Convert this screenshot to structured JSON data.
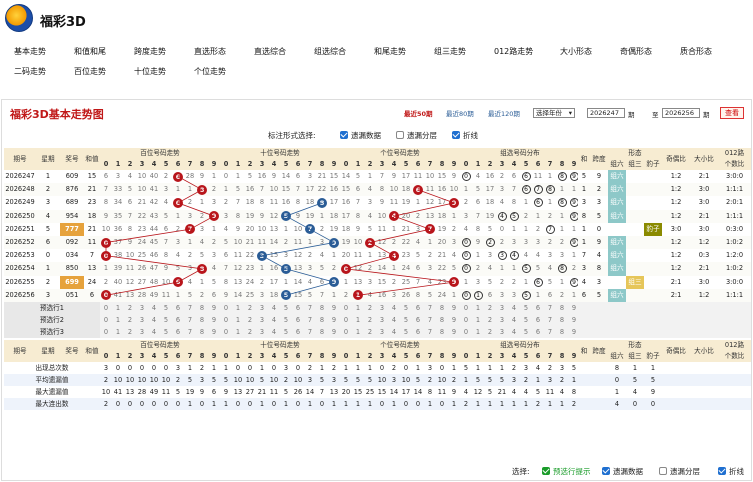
{
  "app": {
    "title": "福彩3D"
  },
  "nav": {
    "items": [
      "基本走势",
      "和值和尾",
      "跨度走势",
      "直选形态",
      "直选综合",
      "组选综合",
      "和尾走势",
      "组三走势",
      "012路走势",
      "大小形态",
      "奇偶形态",
      "质合形态",
      "二码走势",
      "百位走势",
      "十位走势",
      "个位走势"
    ]
  },
  "chart": {
    "title": "福彩3D基本走势图",
    "periods": [
      {
        "label": "最近50期",
        "active": true
      },
      {
        "label": "最近80期",
        "active": false
      },
      {
        "label": "最近120期",
        "active": false
      }
    ],
    "select_label": "选择年份",
    "from": "2026247",
    "to": "2026256",
    "from_suffix": "期",
    "to_label": "至",
    "to_suffix": "期",
    "query_btn": "查看",
    "options_label": "标注形式选择:",
    "options": [
      {
        "label": "遗漏数据",
        "checked": true
      },
      {
        "label": "遗漏分层",
        "checked": false
      },
      {
        "label": "折线",
        "checked": true
      }
    ]
  },
  "headers": {
    "issue": "期号",
    "week": "星期",
    "prize": "奖号",
    "sum": "和值",
    "bai": "百位号码走势",
    "shi": "十位号码走势",
    "ge": "个位号码走势",
    "group": "组选号码分布",
    "hw": "和尾",
    "span": "跨度",
    "shape": "形态",
    "zl": "组六",
    "zs": "组三",
    "bz": "豹子",
    "oe": "奇偶比",
    "bs": "大小比",
    "r012": "012路",
    "r012b": "个数比",
    "digits": [
      "0",
      "1",
      "2",
      "3",
      "4",
      "5",
      "6",
      "7",
      "8",
      "9"
    ]
  },
  "rows": [
    {
      "issue": "2026247",
      "week": "1",
      "prize": "609",
      "sum": "15",
      "bai": [
        6,
        3,
        4,
        10,
        40,
        2,
        "*",
        28,
        9,
        1
      ],
      "shi": [
        0,
        1,
        5,
        16,
        9,
        14,
        6,
        3,
        21,
        15
      ],
      "ge": [
        14,
        5,
        1,
        7,
        9,
        17,
        11,
        10,
        15,
        9
      ],
      "grp": [
        "0",
        4,
        16,
        2,
        6,
        "6",
        11,
        1,
        "8",
        "9"
      ],
      "hw": "5",
      "span": "9",
      "shape": "组六",
      "oe": "1:2",
      "bs": "2:1",
      "r012": "3:0:0",
      "hot": [
        0,
        6,
        9
      ]
    },
    {
      "issue": "2026248",
      "week": "2",
      "prize": "876",
      "sum": "21",
      "bai": [
        7,
        33,
        5,
        10,
        41,
        3,
        1,
        1,
        "*",
        2
      ],
      "shi": [
        1,
        5,
        16,
        7,
        10,
        15,
        7,
        17,
        22,
        16
      ],
      "ge": [
        15,
        6,
        4,
        8,
        10,
        18,
        "*",
        11,
        16,
        10
      ],
      "grp": [
        1,
        5,
        17,
        3,
        7,
        "6",
        "7",
        "8",
        1,
        1
      ],
      "hw": "1",
      "span": "2",
      "shape": "组六",
      "oe": "1:2",
      "bs": "3:0",
      "r012": "1:1:1",
      "hot": [
        6,
        7,
        8
      ]
    },
    {
      "issue": "2026249",
      "week": "3",
      "prize": "689",
      "sum": "23",
      "bai": [
        8,
        34,
        6,
        21,
        42,
        4,
        "*",
        2,
        1,
        3
      ],
      "shi": [
        2,
        7,
        18,
        8,
        11,
        16,
        8,
        18,
        "*",
        17
      ],
      "ge": [
        16,
        7,
        3,
        9,
        11,
        19,
        1,
        12,
        17,
        "*"
      ],
      "grp": [
        2,
        6,
        18,
        4,
        8,
        1,
        "6",
        1,
        "8",
        "9"
      ],
      "hw": "3",
      "span": "3",
      "shape": "组六",
      "oe": "1:2",
      "bs": "3:0",
      "r012": "2:0:1",
      "hot": [
        6,
        8,
        9
      ]
    },
    {
      "issue": "2026250",
      "week": "4",
      "prize": "954",
      "sum": "18",
      "bai": [
        9,
        35,
        7,
        22,
        43,
        5,
        1,
        3,
        2,
        "*"
      ],
      "shi": [
        3,
        8,
        19,
        9,
        12,
        "*",
        9,
        19,
        1,
        18
      ],
      "ge": [
        17,
        8,
        4,
        10,
        "*",
        20,
        2,
        13,
        18,
        1
      ],
      "grp": [
        3,
        7,
        19,
        "4",
        "5",
        2,
        1,
        2,
        1,
        "9"
      ],
      "hw": "8",
      "span": "5",
      "shape": "组六",
      "oe": "1:2",
      "bs": "2:1",
      "r012": "1:1:1",
      "hot": [
        4,
        5,
        9
      ]
    },
    {
      "issue": "2026251",
      "week": "5",
      "prize": "777",
      "sum": "21",
      "bai": [
        10,
        36,
        8,
        23,
        44,
        6,
        2,
        "*",
        3,
        1
      ],
      "shi": [
        4,
        9,
        20,
        10,
        13,
        1,
        10,
        "*",
        2,
        19
      ],
      "ge": [
        18,
        9,
        5,
        11,
        1,
        21,
        3,
        "*",
        19,
        2
      ],
      "grp": [
        4,
        8,
        5,
        0,
        1,
        1,
        2,
        "7",
        1,
        1
      ],
      "hw": "1",
      "span": "0",
      "shape": "豹子",
      "oe": "3:0",
      "bs": "3:0",
      "r012": "0:3:0",
      "hot": [
        7
      ],
      "highlight": true
    },
    {
      "issue": "2026252",
      "week": "6",
      "prize": "092",
      "sum": "11",
      "bai": [
        "*",
        37,
        9,
        24,
        45,
        7,
        3,
        1,
        4,
        2
      ],
      "shi": [
        5,
        10,
        21,
        11,
        14,
        2,
        11,
        1,
        3,
        "*"
      ],
      "ge": [
        19,
        10,
        "*",
        12,
        2,
        22,
        4,
        1,
        20,
        3
      ],
      "grp": [
        "0",
        9,
        "2",
        2,
        3,
        3,
        3,
        2,
        2,
        "9"
      ],
      "hw": "1",
      "span": "9",
      "shape": "组六",
      "oe": "1:2",
      "bs": "1:2",
      "r012": "1:0:2",
      "hot": [
        0,
        2,
        9
      ]
    },
    {
      "issue": "2026253",
      "week": "0",
      "prize": "034",
      "sum": "7",
      "bai": [
        "*",
        38,
        10,
        25,
        46,
        8,
        4,
        2,
        5,
        3
      ],
      "shi": [
        6,
        11,
        22,
        "*",
        15,
        3,
        12,
        2,
        4,
        1
      ],
      "ge": [
        20,
        11,
        1,
        13,
        "*",
        23,
        5,
        2,
        21,
        4
      ],
      "grp": [
        "0",
        1,
        3,
        "3",
        "4",
        4,
        4,
        3,
        3,
        1
      ],
      "hw": "7",
      "span": "4",
      "shape": "组六",
      "oe": "1:2",
      "bs": "0:3",
      "r012": "1:2:0",
      "hot": [
        0,
        3,
        4
      ]
    },
    {
      "issue": "2026254",
      "week": "1",
      "prize": "850",
      "sum": "13",
      "bai": [
        1,
        39,
        11,
        26,
        47,
        9,
        5,
        3,
        "*",
        4
      ],
      "shi": [
        7,
        12,
        23,
        1,
        16,
        "*",
        13,
        3,
        5,
        2
      ],
      "ge": [
        "*",
        12,
        2,
        14,
        1,
        24,
        6,
        3,
        22,
        5
      ],
      "grp": [
        "0",
        2,
        4,
        1,
        1,
        "5",
        5,
        4,
        "8",
        2
      ],
      "hw": "3",
      "span": "8",
      "shape": "组六",
      "oe": "1:2",
      "bs": "2:1",
      "r012": "1:0:2",
      "hot": [
        0,
        5,
        8
      ]
    },
    {
      "issue": "2026255",
      "week": "2",
      "prize": "699",
      "sum": "24",
      "bai": [
        2,
        40,
        12,
        27,
        48,
        10,
        "*",
        4,
        1,
        5
      ],
      "shi": [
        8,
        13,
        24,
        2,
        17,
        1,
        14,
        4,
        6,
        "*"
      ],
      "ge": [
        1,
        13,
        3,
        15,
        2,
        25,
        7,
        4,
        23,
        "*"
      ],
      "grp": [
        1,
        3,
        5,
        2,
        2,
        1,
        "6",
        5,
        1,
        "9"
      ],
      "hw": "4",
      "span": "3",
      "shape": "组三",
      "oe": "2:1",
      "bs": "3:0",
      "r012": "3:0:0",
      "hot": [
        6,
        9
      ],
      "highlight": true
    },
    {
      "issue": "2026256",
      "week": "3",
      "prize": "051",
      "sum": "6",
      "bai": [
        "*",
        41,
        13,
        28,
        49,
        11,
        1,
        5,
        2,
        6
      ],
      "shi": [
        9,
        14,
        25,
        3,
        18,
        "*",
        15,
        5,
        7,
        1
      ],
      "ge": [
        2,
        "*",
        4,
        16,
        3,
        26,
        8,
        5,
        24,
        1
      ],
      "grp": [
        "0",
        "1",
        6,
        3,
        3,
        "5",
        1,
        6,
        2,
        1
      ],
      "hw": "6",
      "span": "5",
      "shape": "组六",
      "oe": "2:1",
      "bs": "1:2",
      "r012": "1:1:1",
      "hot": [
        0,
        1,
        5
      ]
    }
  ],
  "predict": [
    "预选行1",
    "预选行2",
    "预选行3"
  ],
  "stats": [
    {
      "label": "出现总次数",
      "bai": [
        3,
        0,
        0,
        0,
        0,
        0,
        3,
        1,
        2,
        1
      ],
      "shi": [
        1,
        0,
        0,
        1,
        0,
        3,
        0,
        2,
        1,
        2
      ],
      "ge": [
        1,
        1,
        1,
        0,
        2,
        0,
        1,
        3,
        0,
        1
      ],
      "grp": [
        5,
        1,
        1,
        1,
        2,
        3,
        4,
        2,
        3,
        5
      ],
      "shape": [
        8,
        1,
        1
      ]
    },
    {
      "label": "平均遗漏值",
      "bai": [
        2,
        10,
        10,
        10,
        10,
        10,
        2,
        5,
        3,
        5
      ],
      "shi": [
        5,
        10,
        10,
        5,
        10,
        2,
        10,
        3,
        5,
        3
      ],
      "ge": [
        5,
        5,
        5,
        10,
        3,
        10,
        5,
        2,
        10,
        2
      ],
      "grp": [
        1,
        5,
        5,
        5,
        3,
        2,
        1,
        3,
        2,
        1
      ],
      "shape": [
        0,
        5,
        5
      ]
    },
    {
      "label": "最大遗漏值",
      "bai": [
        10,
        41,
        13,
        28,
        49,
        11,
        5,
        19,
        9,
        6
      ],
      "shi": [
        9,
        13,
        27,
        21,
        11,
        5,
        26,
        14,
        7,
        13
      ],
      "ge": [
        20,
        15,
        25,
        15,
        14,
        17,
        14,
        8,
        11,
        9
      ],
      "grp": [
        4,
        12,
        5,
        21,
        4,
        4,
        5,
        11,
        4,
        8
      ],
      "shape": [
        1,
        4,
        9
      ]
    },
    {
      "label": "最大连出数",
      "bai": [
        2,
        0,
        0,
        0,
        0,
        0,
        0,
        1,
        0,
        1
      ],
      "shi": [
        1,
        0,
        0,
        1,
        0,
        1,
        0,
        1,
        0,
        1
      ],
      "ge": [
        1,
        1,
        1,
        0,
        1,
        0,
        0,
        1,
        0,
        1
      ],
      "grp": [
        2,
        1,
        1,
        1,
        1,
        1,
        2,
        1,
        1,
        2
      ],
      "shape": [
        4,
        0,
        0
      ]
    }
  ],
  "footer": {
    "label": "选择:",
    "options": [
      {
        "label": "预选行提示",
        "checked": true,
        "green": true
      },
      {
        "label": "遗漏数据",
        "checked": true
      },
      {
        "label": "遗漏分层",
        "checked": false
      },
      {
        "label": "折线",
        "checked": true
      }
    ]
  },
  "colors": {
    "accent": "#c01818",
    "header_bg": "#f7ecd2",
    "ball_red": "#b8151b",
    "ball_blue": "#2a5c96",
    "highlight": "#e6a23c"
  }
}
